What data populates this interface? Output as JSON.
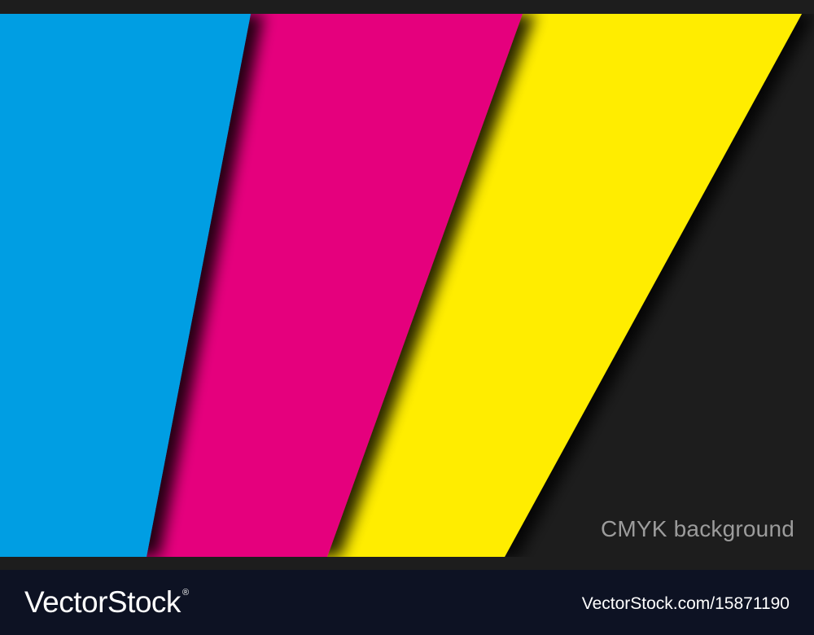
{
  "artwork": {
    "caption": "CMYK background",
    "colors": {
      "background": "#1d1d1d",
      "cyan": "#009ee3",
      "magenta": "#e5007d",
      "yellow": "#ffed00",
      "caption": "#9c9c9c"
    }
  },
  "footer": {
    "logo": {
      "text": "VectorStock",
      "registered_mark": "®"
    },
    "stock_url": "VectorStock.com/15871190",
    "background_color": "#0d1223"
  }
}
